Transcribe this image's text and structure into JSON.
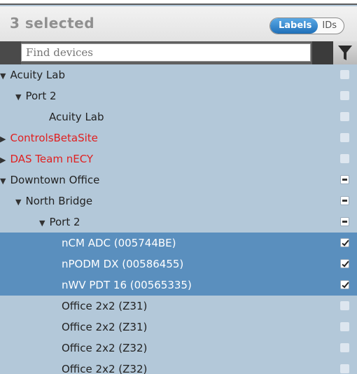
{
  "header": {
    "selected_count": "3 selected"
  },
  "toggle": {
    "labels": "Labels",
    "ids": "IDs",
    "active": "Labels"
  },
  "search": {
    "placeholder": "Find devices"
  },
  "tree": [
    {
      "label": "Acuity Lab",
      "level": 0,
      "expander": "expanded",
      "label_color": "normal",
      "check": "unchecked",
      "selected": false
    },
    {
      "label": "Port 2",
      "level": 1,
      "expander": "expanded",
      "label_color": "normal",
      "check": "unchecked",
      "selected": false
    },
    {
      "label": "Acuity Lab",
      "level": 2,
      "expander": "none",
      "label_color": "normal",
      "check": "unchecked",
      "selected": false
    },
    {
      "label": "ControlsBetaSite",
      "level": 0,
      "expander": "collapsed",
      "label_color": "red",
      "check": "unchecked",
      "selected": false
    },
    {
      "label": "DAS Team nECY",
      "level": 0,
      "expander": "collapsed",
      "label_color": "red",
      "check": "unchecked",
      "selected": false
    },
    {
      "label": "Downtown Office",
      "level": 0,
      "expander": "expanded",
      "label_color": "normal",
      "check": "partial",
      "selected": false
    },
    {
      "label": "North Bridge",
      "level": 1,
      "expander": "expanded",
      "label_color": "normal",
      "check": "partial",
      "selected": false
    },
    {
      "label": "Port 2",
      "level": 2,
      "expander": "expanded",
      "label_color": "normal",
      "check": "partial",
      "selected": false
    },
    {
      "label": "nCM ADC (005744BE)",
      "level": 3,
      "expander": "none",
      "label_color": "normal",
      "check": "checked",
      "selected": true
    },
    {
      "label": "nPODM DX (00586455)",
      "level": 3,
      "expander": "none",
      "label_color": "normal",
      "check": "checked",
      "selected": true
    },
    {
      "label": "nWV PDT 16 (00565335)",
      "level": 3,
      "expander": "none",
      "label_color": "normal",
      "check": "checked",
      "selected": true
    },
    {
      "label": "Office 2x2 (Z31)",
      "level": 3,
      "expander": "none",
      "label_color": "normal",
      "check": "unchecked",
      "selected": false
    },
    {
      "label": "Office 2x2 (Z31)",
      "level": 3,
      "expander": "none",
      "label_color": "normal",
      "check": "unchecked",
      "selected": false
    },
    {
      "label": "Office 2x2 (Z32)",
      "level": 3,
      "expander": "none",
      "label_color": "normal",
      "check": "unchecked",
      "selected": false
    },
    {
      "label": "Office 2x2 (Z32)",
      "level": 3,
      "expander": "none",
      "label_color": "normal",
      "check": "unchecked",
      "selected": false
    }
  ]
}
